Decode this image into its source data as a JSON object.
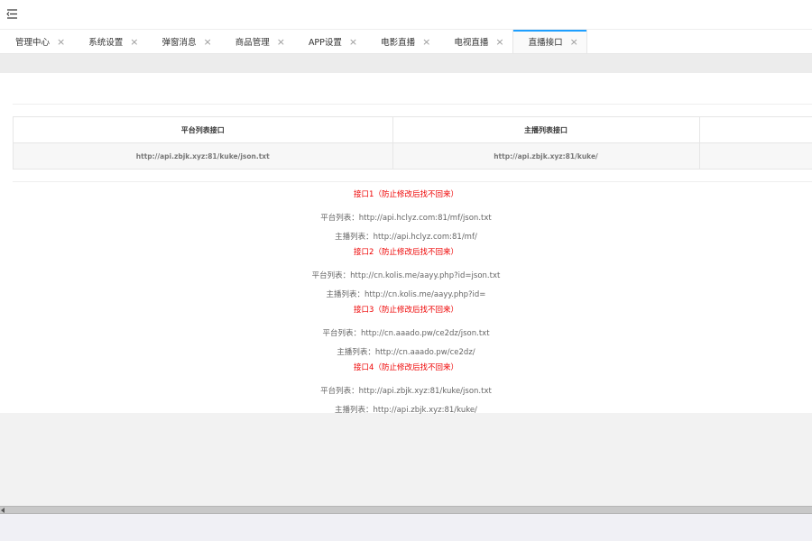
{
  "tabs": [
    {
      "label": "管理中心",
      "active": false
    },
    {
      "label": "系统设置",
      "active": false
    },
    {
      "label": "弹窗消息",
      "active": false
    },
    {
      "label": "商品管理",
      "active": false
    },
    {
      "label": "APP设置",
      "active": false
    },
    {
      "label": "电影直播",
      "active": false
    },
    {
      "label": "电视直播",
      "active": false
    },
    {
      "label": "直播接口",
      "active": true
    }
  ],
  "tab_close_glyph": "×",
  "table": {
    "headers": [
      "平台列表接口",
      "主播列表接口",
      ""
    ],
    "rows": [
      [
        "http://api.zbjk.xyz:81/kuke/json.txt",
        "http://api.zbjk.xyz:81/kuke/",
        ""
      ]
    ]
  },
  "interfaces": [
    {
      "title": "接口1（防止修改后找不回来）",
      "platform": "平台列表：http://api.hclyz.com:81/mf/json.txt",
      "anchor": "主播列表：http://api.hclyz.com:81/mf/"
    },
    {
      "title": "接口2（防止修改后找不回来）",
      "platform": "平台列表：http://cn.kolis.me/aayy.php?id=json.txt",
      "anchor": "主播列表：http://cn.kolis.me/aayy.php?id="
    },
    {
      "title": "接口3（防止修改后找不回来）",
      "platform": "平台列表：http://cn.aaado.pw/ce2dz/json.txt",
      "anchor": "主播列表：http://cn.aaado.pw/ce2dz/"
    },
    {
      "title": "接口4（防止修改后找不回来）",
      "platform": "平台列表：http://api.zbjk.xyz:81/kuke/json.txt",
      "anchor": "主播列表：http://api.zbjk.xyz:81/kuke/"
    }
  ],
  "colors": {
    "accent": "#1e9fff",
    "warning_text": "#ee0000"
  }
}
